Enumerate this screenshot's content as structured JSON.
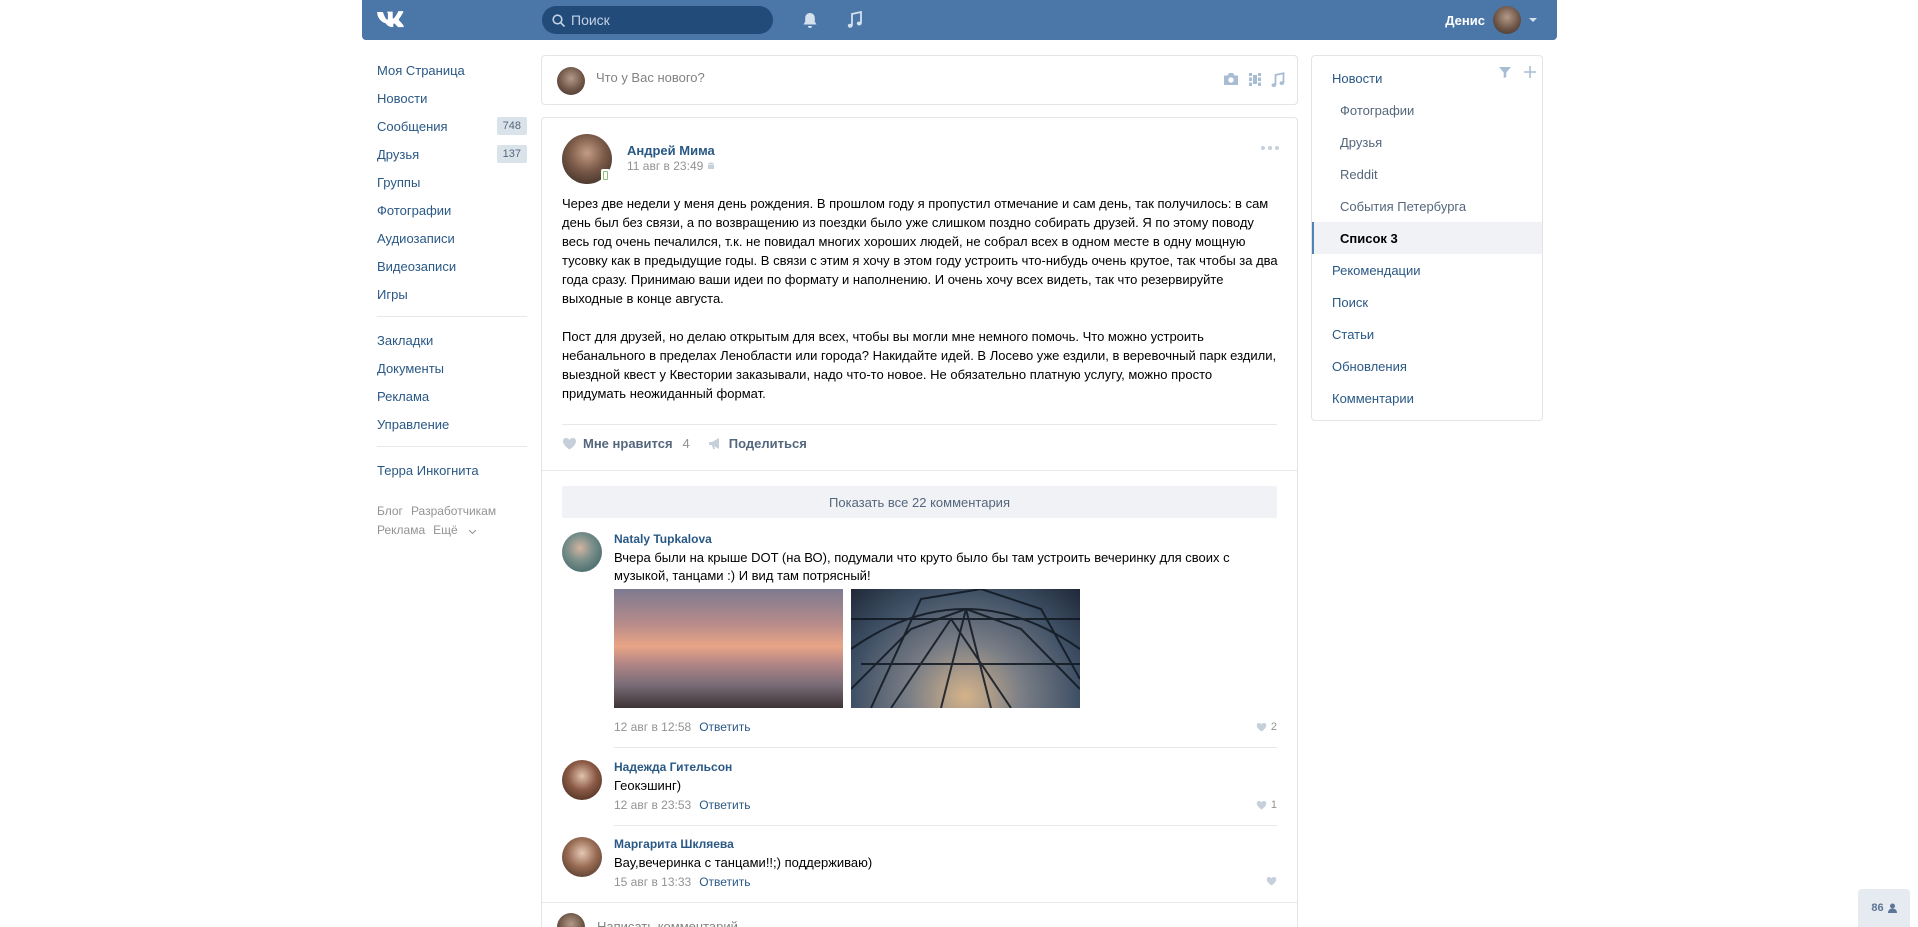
{
  "topbar": {
    "logo_text": "VK",
    "search_placeholder": "Поиск",
    "icons": [
      "bell-icon",
      "music-icon"
    ],
    "user_name": "Денис"
  },
  "leftnav": {
    "items": [
      {
        "label": "Моя Страница"
      },
      {
        "label": "Новости"
      },
      {
        "label": "Сообщения",
        "badge": "748"
      },
      {
        "label": "Друзья",
        "badge": "137"
      },
      {
        "label": "Группы"
      },
      {
        "label": "Фотографии"
      },
      {
        "label": "Аудиозаписи"
      },
      {
        "label": "Видеозаписи"
      },
      {
        "label": "Игры"
      }
    ],
    "items2": [
      {
        "label": "Закладки"
      },
      {
        "label": "Документы"
      },
      {
        "label": "Реклама"
      },
      {
        "label": "Управление"
      }
    ],
    "items3": [
      {
        "label": "Терра Инкогнита"
      }
    ],
    "footer": [
      "Блог",
      "Разработчикам",
      "Реклама",
      "Ещё"
    ]
  },
  "composer": {
    "placeholder": "Что у Вас нового?",
    "icons": [
      "camera-icon",
      "video-icon",
      "music-icon"
    ]
  },
  "post": {
    "author": "Андрей Мима",
    "date": "11 авг в 23:49",
    "text": "Через две недели у меня день рождения. В прошлом году я пропустил отмечание и сам день, так получилось: в сам день был без связи, а по возвращению из поездки было уже слишком поздно собирать друзей. Я по этому поводу весь год очень печалился, т.к. не повидал многих хороших людей, не собрал всех в одном месте в одну мощную тусовку как в предыдущие годы. В связи с этим я хочу в этом году устроить что-нибудь очень крутое, так чтобы за два года сразу. Принимаю ваши идеи по формату и наполнению. И очень хочу всех видеть, так что резервируйте выходные в конце августа.\n\nПост для друзей, но делаю открытым для всех, чтобы вы могли мне немного помочь. Что можно устроить небанального в пределах Ленобласти или города? Накидайте идей. В Лосево уже ездили, в веревочный парк ездили, выездной квест у Квестории заказывали, надо что-то новое. Не обязательно платную услугу, можно просто придумать неожиданный формат.",
    "like_label": "Мне нравится",
    "like_count": "4",
    "share_label": "Поделиться",
    "show_all_comments": "Показать все 22 комментария"
  },
  "comments": [
    {
      "author": "Nataly Tupkalova",
      "text": "Вчера были на крыше DOT (на ВО), подумали что круто было бы там устроить вечеринку для своих с музыкой, танцами :) И вид там потрясный!",
      "date": "12 авг в 12:58",
      "reply": "Ответить",
      "likes": "2"
    },
    {
      "author": "Надежда Гительсон",
      "text": "Геокэшинг)",
      "date": "12 авг в 23:53",
      "reply": "Ответить",
      "likes": "1"
    },
    {
      "author": "Маргарита Шкляева",
      "text": "Вау,вечеринка с танцами!!;) поддерживаю)",
      "date": "15 авг в 13:33",
      "reply": "Ответить",
      "likes": ""
    }
  ],
  "write_comment_placeholder": "Написать комментарий...",
  "rightnav": {
    "title": "Новости",
    "sub_items": [
      "Фотографии",
      "Друзья",
      "Reddit",
      "События Петербурга",
      "Список 3"
    ],
    "active": "Список 3",
    "items": [
      "Рекомендации",
      "Поиск",
      "Статьи",
      "Обновления",
      "Комментарии"
    ]
  },
  "online_widget": {
    "count": "86"
  },
  "colors": {
    "header": "#4a76a8",
    "link": "#2a5885",
    "muted": "#939393",
    "badge_bg": "#dae2ea"
  }
}
